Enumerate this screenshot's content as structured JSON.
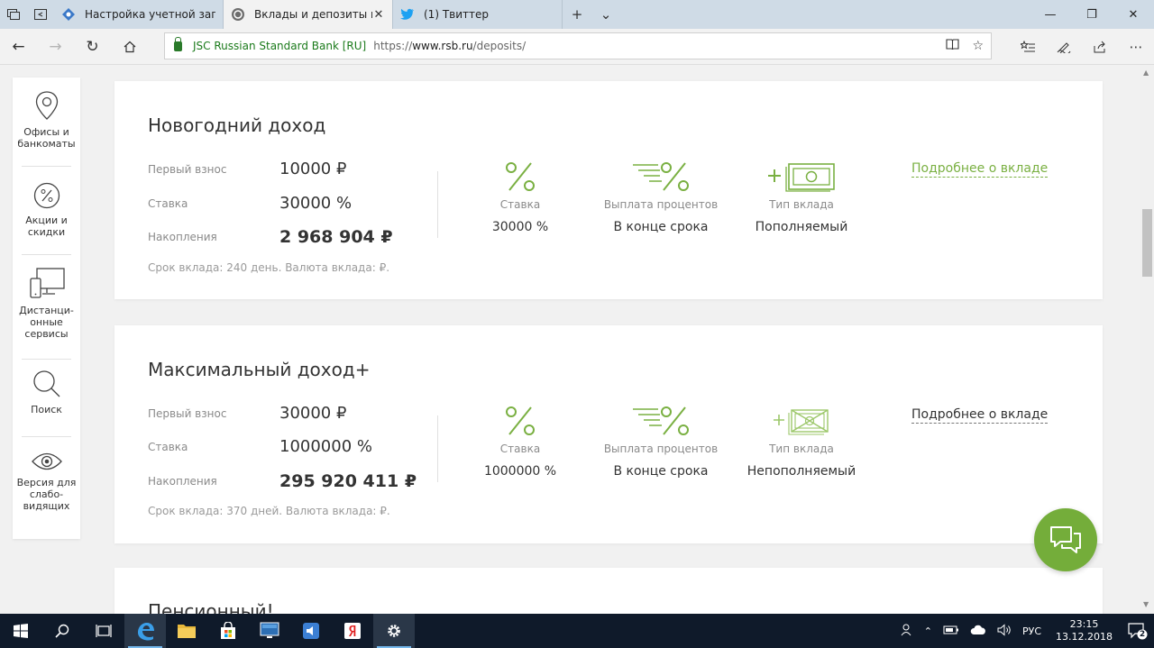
{
  "tabs": [
    {
      "label": "Настройка учетной записи",
      "active": false
    },
    {
      "label": "Вклады и депозиты в М",
      "active": true
    },
    {
      "label": "(1) Твиттер",
      "active": false
    }
  ],
  "address": {
    "site": "JSC Russian Standard Bank [RU]",
    "url_prefix": "https://",
    "url_host": "www.rsb.ru",
    "url_path": "/deposits/"
  },
  "sidebar": {
    "items": [
      {
        "label": "Офисы и банкоматы"
      },
      {
        "label": "Акции и скидки"
      },
      {
        "label": "Дистанци-онные сервисы"
      },
      {
        "label": "Поиск"
      },
      {
        "label": "Версия для слабо-видящих"
      }
    ]
  },
  "deposits": [
    {
      "title": "Новогодний доход",
      "first_payment_label": "Первый взнос",
      "first_payment": "10000 ₽",
      "rate_label": "Ставка",
      "rate": "30000 %",
      "savings_label": "Накопления",
      "savings": "2 968 904 ₽",
      "note": "Срок вклада: 240 день. Валюта вклада: ₽.",
      "features": [
        {
          "label": "Ставка",
          "value": "30000 %",
          "icon": "percent-icon"
        },
        {
          "label": "Выплата процентов",
          "value": "В конце срока",
          "icon": "payout-icon"
        },
        {
          "label": "Тип вклада",
          "value": "Пополняемый",
          "icon": "refillable-icon"
        }
      ],
      "more_link": "Подробнее о вкладе"
    },
    {
      "title": "Максимальный доход+",
      "first_payment_label": "Первый взнос",
      "first_payment": "30000 ₽",
      "rate_label": "Ставка",
      "rate": "1000000 %",
      "savings_label": "Накопления",
      "savings": "295 920 411 ₽",
      "note": "Срок вклада: 370 дней. Валюта вклада: ₽.",
      "features": [
        {
          "label": "Ставка",
          "value": "1000000 %",
          "icon": "percent-icon"
        },
        {
          "label": "Выплата процентов",
          "value": "В конце срока",
          "icon": "payout-icon"
        },
        {
          "label": "Тип вклада",
          "value": "Непополняемый",
          "icon": "non-refillable-icon"
        }
      ],
      "more_link": "Подробнее о вкладе"
    }
  ],
  "third_card_title": "Пенсионный!",
  "taskbar": {
    "lang": "РУС",
    "time": "23:15",
    "date": "13.12.2018",
    "notifications": "2"
  },
  "colors": {
    "accent_green": "#7ab042",
    "chat_green": "#74ad3a"
  }
}
